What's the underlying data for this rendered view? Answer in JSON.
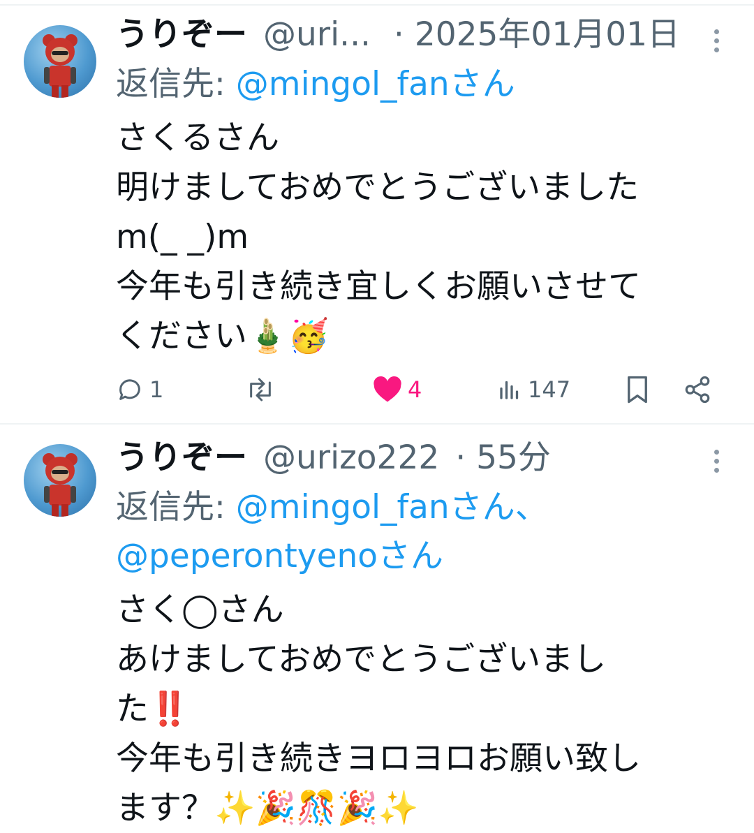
{
  "tweets": [
    {
      "display_name": "うりぞー",
      "handle": "@uri...",
      "separator": "·",
      "time": "2025年01月01日",
      "reply_prefix": "返信先: ",
      "reply_mentions": "@mingol_fanさん",
      "reply_mentions_2": "",
      "body": "さくるさん\n明けましておめでとうございました\nm(_ _)m\n今年も引き続き宜しくお願いさせて\nください🎍🥳",
      "replies": "1",
      "retweets": "",
      "likes": "4",
      "liked": true,
      "views": "147"
    },
    {
      "display_name": "うりぞー",
      "handle": "@urizo222",
      "separator": "·",
      "time": "55分",
      "reply_prefix": "返信先: ",
      "reply_mentions": "@mingol_fanさん、",
      "reply_mentions_2": "@peperontyenoさん",
      "body": "さく◯さん\nあけましておめでとうございまし\nた‼️\n今年も引き続きヨロヨロお願い致し\nます？✨🎉🎊🎉✨"
    }
  ],
  "icons": {
    "more": "more-vertical-icon",
    "reply": "reply-icon",
    "retweet": "retweet-icon",
    "like": "heart-icon",
    "views": "views-icon",
    "bookmark": "bookmark-icon",
    "share": "share-icon"
  },
  "colors": {
    "link": "#1d9bf0",
    "like_active": "#f91880",
    "secondary_text": "#536471"
  }
}
